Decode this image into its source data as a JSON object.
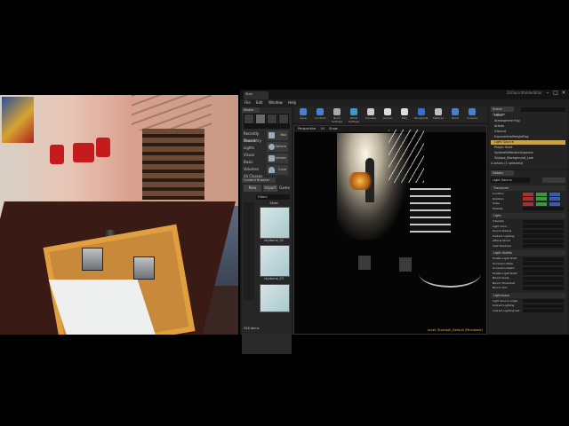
{
  "editor": {
    "window_title": "DUSprintfoldedStair",
    "tab": "Stair",
    "menu": [
      "File",
      "Edit",
      "Window",
      "Help"
    ]
  },
  "modes": {
    "tab": "Modes",
    "categories": [
      "Recently Placed",
      "Geometry",
      "Lights",
      "Visual",
      "Basic",
      "Volumes",
      "All Classes"
    ],
    "items": [
      "Box",
      "Sphere",
      "Cylinder",
      "Cone"
    ]
  },
  "content_browser": {
    "tab": "Content Browser",
    "new_label": "New",
    "import_label": "Import",
    "path": [
      "Game",
      "Materials"
    ],
    "filter_placeholder": "Filters",
    "assets": [
      "Skies",
      "skydome_02",
      "skydome_03"
    ],
    "status": "326 items"
  },
  "toolbar": {
    "tools": [
      {
        "label": "Save",
        "icon": "save-icon",
        "color": "#4a7fd0"
      },
      {
        "label": "Content",
        "icon": "content-icon",
        "color": "#4a7fd0"
      },
      {
        "label": "Build Settings",
        "icon": "build-icon",
        "color": "#aaaaaa"
      },
      {
        "label": "World Settings",
        "icon": "world-icon",
        "color": "#3a9ad0"
      },
      {
        "label": "Preview",
        "icon": "preview-icon",
        "color": "#cccccc"
      },
      {
        "label": "Launch",
        "icon": "launch-icon",
        "color": "#dddddd"
      },
      {
        "label": "Play",
        "icon": "play-icon",
        "color": "#dddddd"
      },
      {
        "label": "Blueprints",
        "icon": "blueprint-icon",
        "color": "#3a6ed0"
      },
      {
        "label": "Matinee",
        "icon": "matinee-icon",
        "color": "#c0c0c0"
      },
      {
        "label": "Build",
        "icon": "build-all-icon",
        "color": "#4a7fd0"
      },
      {
        "label": "Console",
        "icon": "console-icon",
        "color": "#4a7fd0"
      }
    ]
  },
  "viewport": {
    "tabs": [
      "Perspective",
      "Lit",
      "Show"
    ],
    "status": "Level: Stairwell_Default (Persistent)"
  },
  "outliner": {
    "tab": "Scene Outliner",
    "rows": [
      {
        "label": "Label",
        "selected": false
      },
      {
        "label": "Atmosphere Fog",
        "selected": false
      },
      {
        "label": "Artists",
        "selected": false
      },
      {
        "label": "Ground",
        "selected": false
      },
      {
        "label": "ExponentialHeightFog",
        "selected": false
      },
      {
        "label": "Light Source",
        "selected": true
      },
      {
        "label": "Player Start",
        "selected": false
      },
      {
        "label": "SphereReflectionCapture",
        "selected": false
      },
      {
        "label": "Skybox_Background_Low",
        "selected": false
      }
    ],
    "status": "4 actors (1 selected)"
  },
  "details": {
    "tab": "Details",
    "name": "Light Source",
    "sections": [
      {
        "title": "Transform",
        "props": [
          "Location",
          "Rotation",
          "Scale",
          "Mobility"
        ]
      },
      {
        "title": "Light",
        "props": [
          "Intensity",
          "Light Color",
          "Source Radius",
          "Indirect Lighting",
          "Affects World",
          "Cast Shadows"
        ]
      },
      {
        "title": "Light Shafts",
        "props": [
          "Enable Light Shaft",
          "Occlusion Mask",
          "Occlusion Depth",
          "Enable Light Shaft",
          "Bloom Scale",
          "Bloom Threshold",
          "Bloom Tint"
        ]
      },
      {
        "title": "Lightmass",
        "props": [
          "Light Source Angle",
          "Indirect Lighting",
          "Indirect Lighting Sat"
        ]
      }
    ]
  }
}
